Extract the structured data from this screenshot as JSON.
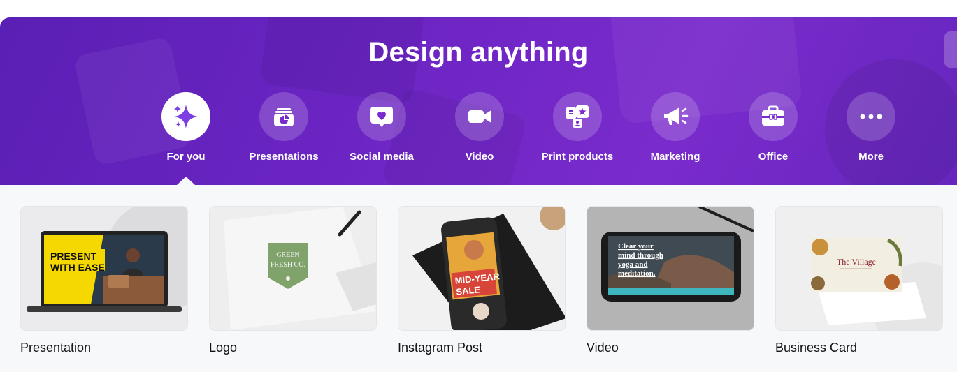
{
  "hero": {
    "title": "Design anything",
    "categories": [
      {
        "label": "For you",
        "icon": "sparkle-icon",
        "active": true
      },
      {
        "label": "Presentations",
        "icon": "presentation-icon",
        "active": false
      },
      {
        "label": "Social media",
        "icon": "heart-bubble-icon",
        "active": false
      },
      {
        "label": "Video",
        "icon": "video-camera-icon",
        "active": false
      },
      {
        "label": "Print products",
        "icon": "print-products-icon",
        "active": false
      },
      {
        "label": "Marketing",
        "icon": "megaphone-icon",
        "active": false
      },
      {
        "label": "Office",
        "icon": "briefcase-icon",
        "active": false
      },
      {
        "label": "More",
        "icon": "more-dots-icon",
        "active": false
      }
    ]
  },
  "cards": [
    {
      "label": "Presentation",
      "thumb_text": [
        "PRESENT",
        "WITH EASE"
      ]
    },
    {
      "label": "Logo",
      "thumb_text": [
        "GREEN",
        "FRESH CO."
      ]
    },
    {
      "label": "Instagram Post",
      "thumb_text": [
        "MID-YEAR",
        "SALE"
      ]
    },
    {
      "label": "Video",
      "thumb_text": [
        "Clear your",
        "mind through",
        "yoga and",
        "meditation."
      ]
    },
    {
      "label": "Business Card",
      "thumb_text": [
        "The Village"
      ]
    }
  ],
  "colors": {
    "hero_purple": "#6a24c2",
    "active_icon": "#7b3fe4",
    "content_bg": "#f7f8fa"
  }
}
